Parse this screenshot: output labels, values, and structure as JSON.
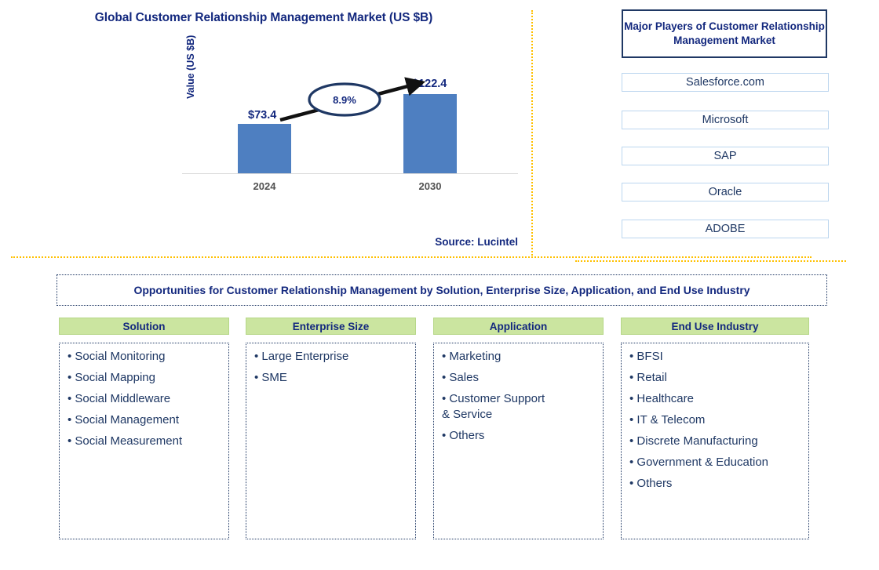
{
  "chart_panel": {
    "title": "Global Customer Relationship Management Market (US $B)",
    "y_axis_label": "Value (US $B)",
    "source": "Source: Lucintel"
  },
  "chart_data": {
    "type": "bar",
    "title": "Global Customer Relationship Management Market (US $B)",
    "categories": [
      "2024",
      "2030"
    ],
    "values": [
      73.4,
      122.4
    ],
    "value_labels": [
      "$73.4",
      "$122.4"
    ],
    "cagr_label": "8.9%",
    "xlabel": "",
    "ylabel": "Value (US $B)",
    "ylim": [
      0,
      140
    ],
    "grid": false,
    "legend": "none",
    "bar_color": "#4e7fc1",
    "annotation": "8.9% CAGR arrow from 2024 bar to 2030 bar"
  },
  "players": {
    "header": "Major Players of Customer Relationship Management Market",
    "items": [
      "Salesforce.com",
      "Microsoft",
      "SAP",
      "Oracle",
      "ADOBE"
    ]
  },
  "opportunities": {
    "banner": "Opportunities for Customer Relationship Management by Solution, Enterprise Size, Application, and End Use Industry",
    "columns": [
      {
        "header": "Solution",
        "items": [
          "Social Monitoring",
          "Social Mapping",
          "Social Middleware",
          "Social Management",
          "Social Measurement"
        ]
      },
      {
        "header": "Enterprise Size",
        "items": [
          "Large Enterprise",
          "SME"
        ]
      },
      {
        "header": "Application",
        "items": [
          "Marketing",
          "Sales",
          "Customer Support\n& Service",
          "Others"
        ]
      },
      {
        "header": "End Use Industry",
        "items": [
          "BFSI",
          "Retail",
          "Healthcare",
          "IT & Telecom",
          "Discrete Manufacturing",
          "Government & Education",
          "Others"
        ]
      }
    ]
  },
  "colors": {
    "navy": "#13287e",
    "text_navy": "#1f3864",
    "bar_blue": "#4e7fc1",
    "green_header": "#cbe5a0",
    "orange_divider": "#ffc000"
  }
}
